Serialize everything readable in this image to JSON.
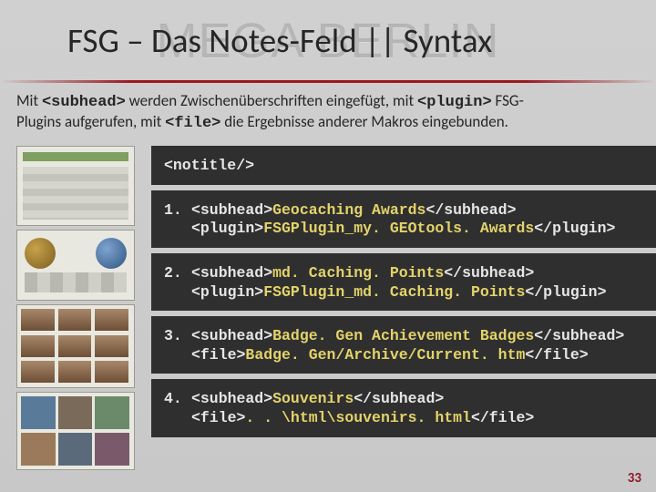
{
  "bg_logo": "MEGA BERLIN",
  "title": "FSG – Das Notes-Feld || Syntax",
  "intro": {
    "pre1": "Mit ",
    "tag1": "<subhead>",
    "mid1": " werden Zwischenüberschriften eingefügt, mit ",
    "tag2": "<plugin>",
    "mid2": " FSG-",
    "line2a": "Plugins aufgerufen, mit ",
    "tag3": "<file>",
    "line2b": " die Ergebnisse anderer Makros eingebunden."
  },
  "code": {
    "notitle": "<notitle/>",
    "items": [
      {
        "num": "1.",
        "l1a": "<subhead>",
        "l1v": "Geocaching Awards",
        "l1b": "</subhead>",
        "l2a": "<plugin>",
        "l2v": "FSGPlugin_my. GEOtools. Awards",
        "l2b": "</plugin>"
      },
      {
        "num": "2.",
        "l1a": "<subhead>",
        "l1v": "md. Caching. Points",
        "l1b": "</subhead>",
        "l2a": "<plugin>",
        "l2v": "FSGPlugin_md. Caching. Points",
        "l2b": "</plugin>"
      },
      {
        "num": "3.",
        "l1a": "<subhead>",
        "l1v": "Badge. Gen Achievement Badges",
        "l1b": "</subhead>",
        "l2a": "<file>",
        "l2v": "Badge. Gen/Archive/Current. htm",
        "l2b": "</file>"
      },
      {
        "num": "4.",
        "l1a": "<subhead>",
        "l1v": "Souvenirs",
        "l1b": "</subhead>",
        "l2a": "<file>",
        "l2v": ". . \\html\\souvenirs. html",
        "l2b": "</file>"
      }
    ]
  },
  "page_number": "33"
}
